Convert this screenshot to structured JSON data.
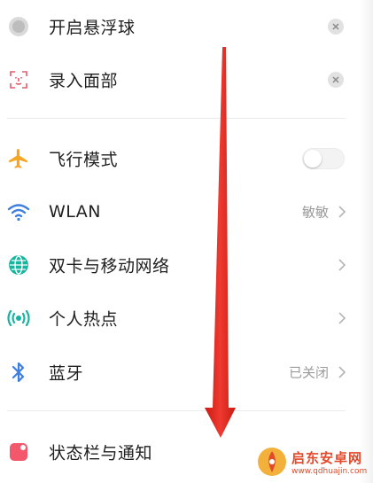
{
  "settings": {
    "items": [
      {
        "label": "开启悬浮球",
        "icon": "floating-ball-icon"
      },
      {
        "label": "录入面部",
        "icon": "face-recognition-icon"
      },
      {
        "label": "飞行模式",
        "icon": "airplane-icon",
        "toggle_on": false
      },
      {
        "label": "WLAN",
        "icon": "wifi-icon",
        "value": "敏敏"
      },
      {
        "label": "双卡与移动网络",
        "icon": "globe-network-icon"
      },
      {
        "label": "个人热点",
        "icon": "hotspot-icon"
      },
      {
        "label": "蓝牙",
        "icon": "bluetooth-icon",
        "value": "已关闭"
      },
      {
        "label": "状态栏与通知",
        "icon": "status-bar-icon"
      }
    ]
  },
  "annotation": {
    "arrow_color": "#e8271f",
    "direction": "down"
  },
  "watermark": {
    "title": "启东安卓网",
    "url": "www.qdhuajin.com"
  },
  "colors": {
    "airplane": "#f5a623",
    "wifi": "#3d7ee0",
    "globe": "#16b5a0",
    "hotspot": "#16b5a0",
    "bluetooth": "#3d7ee0",
    "face": "#e55a6b",
    "status_bar": "#f2576b"
  }
}
